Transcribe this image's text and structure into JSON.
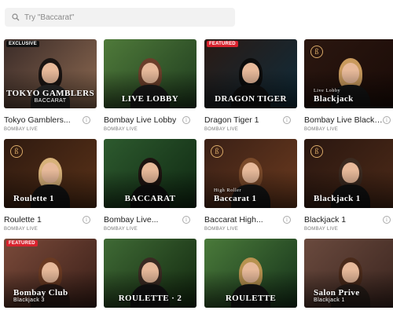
{
  "search": {
    "placeholder": "Try \"Baccarat\""
  },
  "games": [
    {
      "title": "Tokyo Gamblers...",
      "provider": "BOMBAY LIVE",
      "badge": "EXCLUSIVE",
      "overlay": "TOKYO GAMBLERS",
      "overlay_sub": "",
      "overlay_sub2": "BACCARAT",
      "logo": "",
      "colors": {
        "bg1": "#3a2b28",
        "bg2": "#8f6b52",
        "body": "#2a2a2a",
        "hair": "#1a1412"
      }
    },
    {
      "title": "Bombay Live Lobby",
      "provider": "BOMBAY LIVE",
      "badge": "",
      "overlay": "LIVE LOBBY",
      "overlay_sub": "",
      "overlay_sub2": "",
      "logo": "",
      "colors": {
        "bg1": "#4f7a3a",
        "bg2": "#1e3b1e",
        "body": "#1b1b1b",
        "hair": "#6b3e2a"
      }
    },
    {
      "title": "Dragon Tiger 1",
      "provider": "BOMBAY LIVE",
      "badge": "FEATURED",
      "overlay": "DRAGON TIGER",
      "overlay_sub": "",
      "overlay_sub2": "",
      "logo": "",
      "colors": {
        "bg1": "#2a1a14",
        "bg2": "#0f2c3b",
        "body": "#111111",
        "hair": "#0c0c0c"
      }
    },
    {
      "title": "Bombay Live Blackja...",
      "provider": "BOMBAY LIVE",
      "badge": "",
      "overlay": "Blackjack",
      "overlay_sub": "Live Lobby",
      "overlay_sub2": "",
      "logo": "ß",
      "colors": {
        "bg1": "#2b1710",
        "bg2": "#1a0b07",
        "body": "#151515",
        "hair": "#c99a5d"
      }
    },
    {
      "title": "Roulette 1",
      "provider": "BOMBAY LIVE",
      "badge": "",
      "overlay": "Roulette 1",
      "overlay_sub": "",
      "overlay_sub2": "",
      "logo": "ß",
      "colors": {
        "bg1": "#2f1a10",
        "bg2": "#5a3218",
        "body": "#141414",
        "hair": "#d8b27a"
      }
    },
    {
      "title": "Bombay Live...",
      "provider": "BOMBAY LIVE",
      "badge": "",
      "overlay": "BACCARAT",
      "overlay_sub": "",
      "overlay_sub2": "",
      "logo": "",
      "colors": {
        "bg1": "#2d5a2e",
        "bg2": "#0f2812",
        "body": "#0f0f0f",
        "hair": "#1d1310"
      }
    },
    {
      "title": "Baccarat High...",
      "provider": "BOMBAY LIVE",
      "badge": "",
      "overlay": "Baccarat 1",
      "overlay_sub": "High Roller",
      "overlay_sub2": "",
      "logo": "ß",
      "colors": {
        "bg1": "#3a2016",
        "bg2": "#6b3a1e",
        "body": "#151515",
        "hair": "#7a4a2a"
      }
    },
    {
      "title": "Blackjack 1",
      "provider": "BOMBAY LIVE",
      "badge": "",
      "overlay": "Blackjack 1",
      "overlay_sub": "",
      "overlay_sub2": "",
      "logo": "ß",
      "colors": {
        "bg1": "#2a1710",
        "bg2": "#4d2a18",
        "body": "#121212",
        "hair": "#3b2a20"
      }
    },
    {
      "title": "",
      "provider": "",
      "badge": "FEATURED",
      "overlay": "Bombay Club",
      "overlay_sub": "",
      "overlay_sub2": "Blackjack 3",
      "logo": "",
      "colors": {
        "bg1": "#7a4a3a",
        "bg2": "#3a1f18",
        "body": "#2a1a16",
        "hair": "#6a3a22"
      }
    },
    {
      "title": "",
      "provider": "",
      "badge": "",
      "overlay": "ROULETTE · 2",
      "overlay_sub": "",
      "overlay_sub2": "",
      "logo": "",
      "colors": {
        "bg1": "#3f6a35",
        "bg2": "#12280f",
        "body": "#141414",
        "hair": "#3a2a22"
      }
    },
    {
      "title": "",
      "provider": "",
      "badge": "",
      "overlay": "ROULETTE",
      "overlay_sub": "",
      "overlay_sub2": "",
      "logo": "",
      "colors": {
        "bg1": "#4a7a3a",
        "bg2": "#15321a",
        "body": "#161616",
        "hair": "#b8924f"
      }
    },
    {
      "title": "",
      "provider": "",
      "badge": "",
      "overlay": "Salon Prive",
      "overlay_sub": "",
      "overlay_sub2": "Blackjack 1",
      "logo": "",
      "colors": {
        "bg1": "#6a4a3e",
        "bg2": "#3a241e",
        "body": "#2a1f1a",
        "hair": "#4a2a1a"
      }
    }
  ]
}
